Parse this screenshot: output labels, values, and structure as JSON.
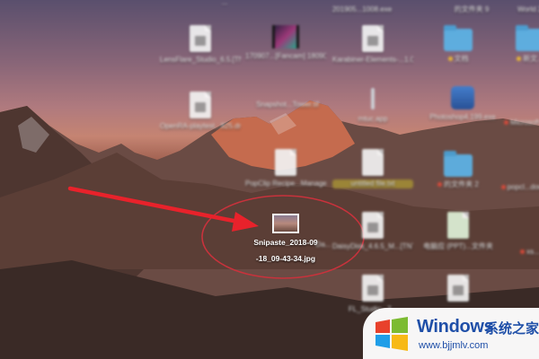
{
  "desktop": {
    "icons": [
      {
        "id": "top-1",
        "label": "...",
        "kind": "file"
      },
      {
        "id": "top-2",
        "label": "201905...1008.exe",
        "kind": "file"
      },
      {
        "id": "top-3",
        "label": "的文件夹 9",
        "kind": "folder"
      },
      {
        "id": "top-4",
        "label": "World 2...",
        "kind": "folder"
      },
      {
        "id": "lensflare",
        "label": "LensFlare_Studio_6.5.[TNT].dmg",
        "kind": "file"
      },
      {
        "id": "fancam",
        "label": "170907...[Fancam]\n180907...[00].mp4",
        "kind": "video"
      },
      {
        "id": "karabiner",
        "label": "Karabiner-Elements-...1.0.dmg",
        "kind": "file"
      },
      {
        "id": "folder-doc",
        "label": "文档",
        "kind": "folder"
      },
      {
        "id": "folder-xn",
        "label": "新文...",
        "kind": "folder"
      },
      {
        "id": "openair",
        "label": "OpenRA-playtest...825.dmg",
        "kind": "file"
      },
      {
        "id": "snapshot",
        "label": "Snapshot...Tower.tif",
        "kind": "file"
      },
      {
        "id": "mtuc",
        "label": "mtuc.app",
        "kind": "app"
      },
      {
        "id": "photoshop",
        "label": "Photoshop4.199.exe",
        "kind": "app"
      },
      {
        "id": "micro",
        "label": "Microsoft 文件",
        "kind": "file"
      },
      {
        "id": "popclip",
        "label": "PopClip Recipe...Management",
        "kind": "file"
      },
      {
        "id": "untitled",
        "label": "untitled file.txt",
        "kind": "file"
      },
      {
        "id": "folder-copy",
        "label": "的文件夹 2",
        "kind": "folder"
      },
      {
        "id": "popclip2",
        "label": "popcl...downlo...",
        "kind": "file"
      },
      {
        "id": "daisy",
        "label": "DaisyDisk_4.6.5_M...[TNT].dmg",
        "kind": "file"
      },
      {
        "id": "cnfile",
        "label": "电脑应 (PPT)...文件夹",
        "kind": "file"
      },
      {
        "id": "xs",
        "label": "xs...",
        "kind": "file"
      },
      {
        "id": "fl",
        "label": "FL_Studio...7...",
        "kind": "file"
      },
      {
        "id": "da",
        "label": "Da...",
        "kind": "file"
      }
    ],
    "selected": {
      "line1": "Snipaste_2018-09",
      "line2": "-18_09-43-34.jpg"
    }
  },
  "watermark": {
    "title": "Windows",
    "subtitle": "系统之家",
    "url": "www.bjjmlv.com"
  },
  "colors": {
    "arrow": "#e8222b",
    "ellipse": "#c8323c",
    "watermark_blue": "#1f4fa8",
    "folder_blue": "#5cb4e8"
  }
}
